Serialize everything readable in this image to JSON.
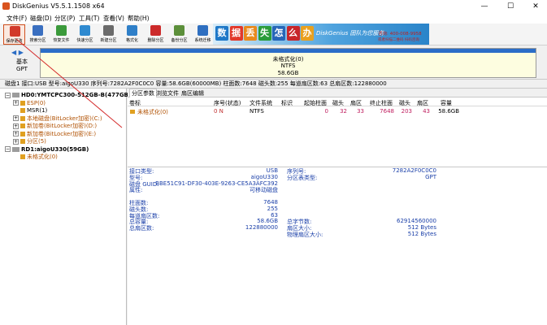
{
  "window": {
    "title": "DiskGenius V5.5.1.1508 x64",
    "minimize": "—",
    "maximize": "☐",
    "close": "✕"
  },
  "menu": [
    "文件(F)",
    "磁盘(D)",
    "分区(P)",
    "工具(T)",
    "查看(V)",
    "帮助(H)"
  ],
  "toolbar": [
    {
      "label": "保存更改",
      "icon": "save-icon",
      "color": "#d23a2a"
    },
    {
      "label": "搜索分区",
      "icon": "search-icon",
      "color": "#3a6fc0"
    },
    {
      "label": "恢复文件",
      "icon": "recover-icon",
      "color": "#3b9a3b"
    },
    {
      "label": "快速分区",
      "icon": "quick-partition-icon",
      "color": "#2f8ad0"
    },
    {
      "label": "新建分区",
      "icon": "new-partition-icon",
      "color": "#6a6a6a"
    },
    {
      "label": "格式化",
      "icon": "format-icon",
      "color": "#2f7fc8"
    },
    {
      "label": "删除分区",
      "icon": "delete-icon",
      "color": "#cc2a2a"
    },
    {
      "label": "备份分区",
      "icon": "backup-icon",
      "color": "#5c8f3a"
    },
    {
      "label": "系统迁移",
      "icon": "migrate-icon",
      "color": "#2f6fc0"
    }
  ],
  "banner": {
    "tiles": [
      {
        "ch": "数",
        "color": "#1e78c8"
      },
      {
        "ch": "据",
        "color": "#e2382a"
      },
      {
        "ch": "丢",
        "color": "#e98a1e"
      },
      {
        "ch": "失",
        "color": "#2a9c3a"
      },
      {
        "ch": "怎",
        "color": "#2666b8"
      },
      {
        "ch": "么",
        "color": "#c8262a"
      },
      {
        "ch": "办",
        "color": "#e9a01e"
      }
    ],
    "slogan": "DiskGenius 团队为您服务",
    "phone": "咨询: 400-008-9958",
    "qq": "或者扫描二维码 扫码咨询"
  },
  "disk_bar": {
    "nav_arrows": "◀ ▶",
    "type_line1": "基本",
    "type_line2": "GPT",
    "partition_name": "未格式化(0)",
    "fs": "NTFS",
    "size": "58.6GB"
  },
  "disk_info": "磁盘1 接口:USB  型号:aigoU330  序列号:7282A2F0C0C0  容量:58.6GB(60000MB)  柱面数:7648  磁头数:255  每道扇区数:63  总扇区数:122880000",
  "tree": [
    {
      "label": "HD0:YMTCPC300-512GB-B(477GB)",
      "indent": 0,
      "exp": "⊟",
      "disk": true,
      "color": "#000000",
      "bold": true
    },
    {
      "label": "ESP(0)",
      "indent": 1,
      "exp": "⊞",
      "color": "#b05000"
    },
    {
      "label": "MSR(1)",
      "indent": 1,
      "exp": "",
      "color": "#000000"
    },
    {
      "label": "本地磁盘(BitLocker加密)(C:)",
      "indent": 1,
      "exp": "⊞",
      "color": "#b05000"
    },
    {
      "label": "新加卷(BitLocker加密)(D:)",
      "indent": 1,
      "exp": "⊞",
      "color": "#b05000"
    },
    {
      "label": "新加卷(BitLocker加密)(E:)",
      "indent": 1,
      "exp": "⊞",
      "color": "#b05000"
    },
    {
      "label": "分区(5)",
      "indent": 1,
      "exp": "⊞",
      "color": "#b05000"
    },
    {
      "label": "RD1:aigoU330(59GB)",
      "indent": 0,
      "exp": "⊟",
      "disk": true,
      "color": "#000000",
      "bold": true
    },
    {
      "label": "未格式化(0)",
      "indent": 1,
      "exp": "",
      "color": "#b05000"
    }
  ],
  "tabs": [
    "分区参数",
    "浏览文件",
    "扇区编辑"
  ],
  "table_headers": [
    "卷标",
    "序号(状态)",
    "文件系统",
    "标识",
    "起始柱面",
    "磁头",
    "扇区",
    "终止柱面",
    "磁头",
    "扇区",
    "容量"
  ],
  "table_rows": [
    [
      "未格式化(0)",
      "0 N",
      "NTFS",
      "",
      "0",
      "32",
      "33",
      "7648",
      "203",
      "43",
      "58.6GB"
    ]
  ],
  "details_left": [
    {
      "k": "接口类型:",
      "v": "USB"
    },
    {
      "k": "型号:",
      "v": "aigoU330"
    },
    {
      "k": "磁盘 GUID:",
      "v": "BBE51C91-DF30-403E-9263-CE5A3AFC392"
    },
    {
      "k": "属性:",
      "v": "可移动磁盘"
    },
    {
      "k": "",
      "v": ""
    },
    {
      "k": "柱面数:",
      "v": "7648"
    },
    {
      "k": "磁头数:",
      "v": "255"
    },
    {
      "k": "每道扇区数:",
      "v": "63"
    },
    {
      "k": "总容量:",
      "v": "58.6GB"
    },
    {
      "k": "总扇区数:",
      "v": "122880000"
    }
  ],
  "details_right": [
    {
      "k": "序列号:",
      "v": "7282A2F0C0C0"
    },
    {
      "k": "分区表类型:",
      "v": "GPT"
    },
    {
      "k": "",
      "v": ""
    },
    {
      "k": "",
      "v": ""
    },
    {
      "k": "",
      "v": ""
    },
    {
      "k": "",
      "v": ""
    },
    {
      "k": "",
      "v": ""
    },
    {
      "k": "",
      "v": ""
    },
    {
      "k": "总字节数:",
      "v": "62914560000"
    },
    {
      "k": "扇区大小:",
      "v": "512 Bytes"
    },
    {
      "k": "物理扇区大小:",
      "v": "512 Bytes"
    }
  ]
}
